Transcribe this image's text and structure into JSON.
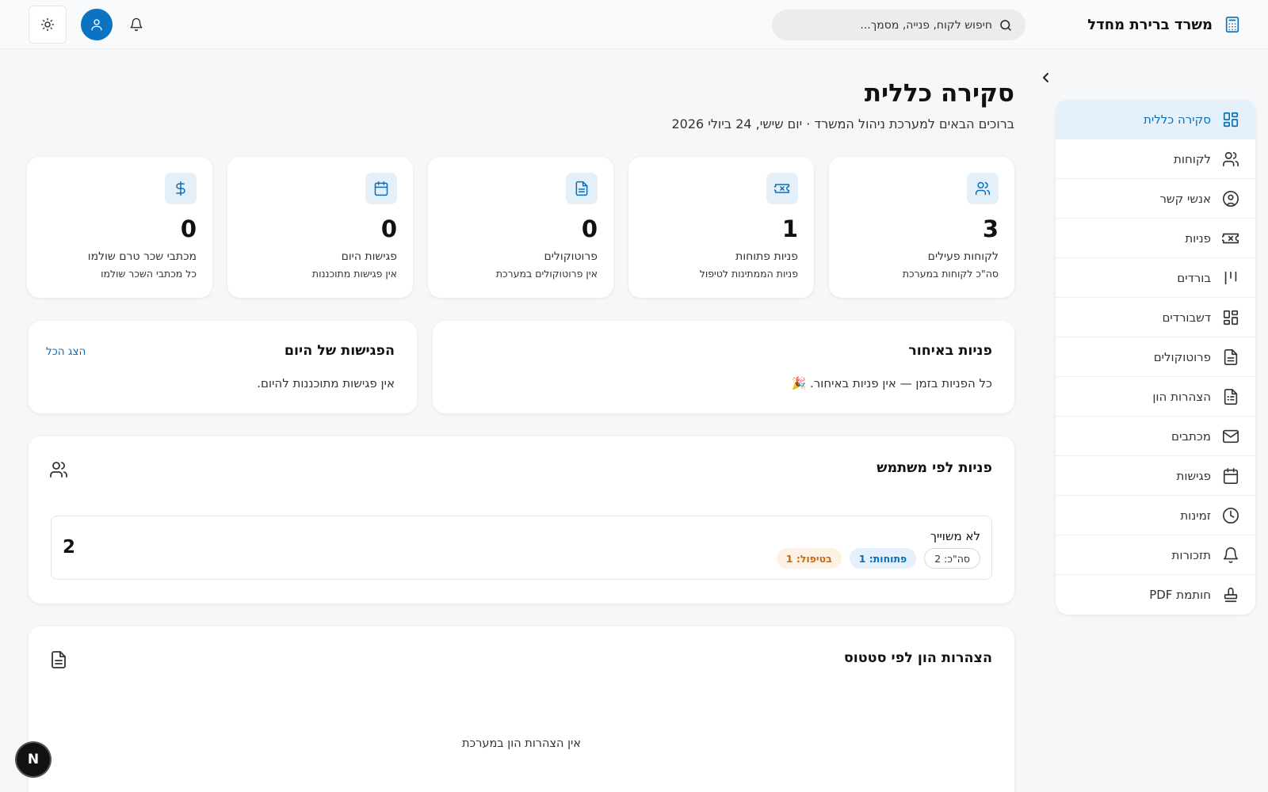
{
  "header": {
    "brand_title": "משרד ברירת מחדל",
    "search_placeholder": "חיפוש לקוח, פנייה, מסמך..."
  },
  "sidebar": {
    "items": [
      {
        "label": "סקירה כללית",
        "icon": "dashboard-icon",
        "active": true
      },
      {
        "label": "לקוחות",
        "icon": "users-icon"
      },
      {
        "label": "אנשי קשר",
        "icon": "user-circle-icon"
      },
      {
        "label": "פניות",
        "icon": "ticket-icon"
      },
      {
        "label": "בורדים",
        "icon": "kanban-icon"
      },
      {
        "label": "דשבורדים",
        "icon": "grid-icon"
      },
      {
        "label": "פרוטוקולים",
        "icon": "document-icon"
      },
      {
        "label": "הצהרות הון",
        "icon": "spreadsheet-icon"
      },
      {
        "label": "מכתבים",
        "icon": "mail-icon"
      },
      {
        "label": "פגישות",
        "icon": "calendar-icon"
      },
      {
        "label": "זמינות",
        "icon": "clock-icon"
      },
      {
        "label": "תזכורות",
        "icon": "bell-icon"
      },
      {
        "label": "חותמת PDF",
        "icon": "stamp-icon"
      }
    ]
  },
  "page": {
    "title": "סקירה כללית",
    "subtitle": "ברוכים הבאים למערכת ניהול המשרד · יום שישי, 24 ביולי 2026"
  },
  "stats": [
    {
      "value": "3",
      "label": "לקוחות פעילים",
      "desc": "סה\"כ לקוחות במערכת",
      "icon": "users-icon"
    },
    {
      "value": "1",
      "label": "פניות פתוחות",
      "desc": "פניות הממתינות לטיפול",
      "icon": "ticket-icon"
    },
    {
      "value": "0",
      "label": "פרוטוקולים",
      "desc": "אין פרוטוקולים במערכת",
      "icon": "document-icon"
    },
    {
      "value": "0",
      "label": "פגישות היום",
      "desc": "אין פגישות מתוכננות",
      "icon": "calendar-icon"
    },
    {
      "value": "0",
      "label": "מכתבי שכר טרם שולמו",
      "desc": "כל מכתבי השכר שולמו",
      "icon": "dollar-icon"
    }
  ],
  "late_tickets": {
    "title": "פניות באיחור",
    "text": "כל הפניות בזמן — אין פניות באיחור. 🎉"
  },
  "today_meetings": {
    "title": "הפגישות של היום",
    "show_all": "הצג הכל",
    "text": "אין פגישות מתוכננות להיום."
  },
  "tickets_by_user": {
    "title": "פניות לפי משתמש",
    "rows": [
      {
        "name": "לא משוייך",
        "total": "2",
        "badge_total": "סה\"כ: 2",
        "badge_open": "פתוחות: 1",
        "badge_progress": "בטיפול: 1"
      }
    ]
  },
  "capital_statements": {
    "title": "הצהרות הון לפי סטטוס",
    "empty": "אין הצהרות הון במערכת"
  },
  "dev_badge": "N"
}
